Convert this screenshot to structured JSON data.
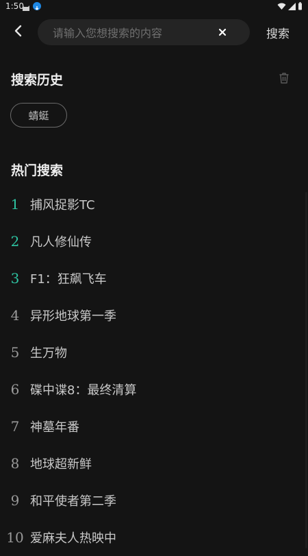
{
  "status": {
    "time": "1:50"
  },
  "search": {
    "placeholder": "请输入您想搜索的内容",
    "value": "",
    "submit_label": "搜索"
  },
  "history": {
    "title": "搜索历史",
    "items": [
      "蜻蜓"
    ]
  },
  "hot": {
    "title": "热门搜索",
    "items": [
      {
        "rank": "1",
        "title": "捕风捉影TC"
      },
      {
        "rank": "2",
        "title": "凡人修仙传"
      },
      {
        "rank": "3",
        "title": "F1：狂飙飞车"
      },
      {
        "rank": "4",
        "title": "异形地球第一季"
      },
      {
        "rank": "5",
        "title": "生万物"
      },
      {
        "rank": "6",
        "title": "碟中谍8：最终清算"
      },
      {
        "rank": "7",
        "title": "神墓年番"
      },
      {
        "rank": "8",
        "title": "地球超新鲜"
      },
      {
        "rank": "9",
        "title": "和平使者第二季"
      },
      {
        "rank": "10",
        "title": "爱麻夫人热映中"
      }
    ]
  },
  "colors": {
    "background": "#141414",
    "accent_rank": "#2ec5a3",
    "search_box": "#242424"
  }
}
